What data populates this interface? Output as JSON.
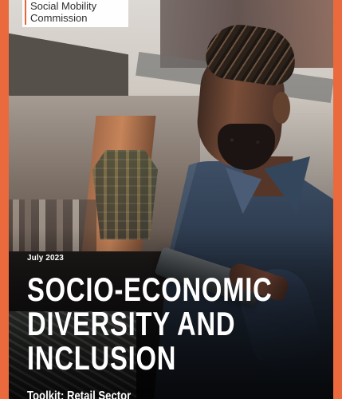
{
  "brand": {
    "name_line1": "Social Mobility",
    "name_line2": "Commission",
    "accent_color": "#e9643a"
  },
  "cover": {
    "date": "July 2023",
    "title_lines": [
      "SOCIO-ECONOMIC",
      "DIVERSITY AND",
      "INCLUSION"
    ],
    "subtitle": "Toolkit: Retail Sector"
  }
}
